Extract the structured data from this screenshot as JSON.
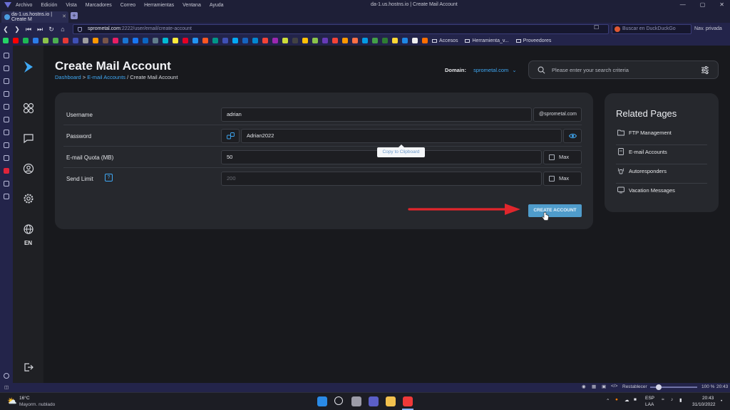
{
  "browser": {
    "menu": [
      "Archivo",
      "Edición",
      "Vista",
      "Marcadores",
      "Correo",
      "Herramientas",
      "Ventana",
      "Ayuda"
    ],
    "window_title": "da-1.us.hostns.io | Create Mail Account",
    "tab_title": "da-1.us.hostns.io | Create M",
    "url_host": "sprometal.com",
    "url_path": ":2222/user/email/create-account",
    "search_placeholder": "Buscar en DuckDuckGo",
    "private_label": "Nav. privada",
    "bookmarks": [
      "Accesos",
      "Herramienta_v...",
      "Proveedores"
    ],
    "statusbar": {
      "reset": "Restablecer",
      "zoom": "100 %",
      "time": "20:43"
    }
  },
  "app": {
    "nav_items": [
      "apps-icon",
      "chat-icon",
      "user-icon",
      "gear-icon",
      "globe-icon"
    ],
    "language": "EN",
    "page_title": "Create Mail Account",
    "breadcrumb": {
      "dashboard": "Dashboard",
      "sep": ">",
      "email_accounts": "E-mail Accounts",
      "current": "/ Create Mail Account"
    },
    "domain_label": "Domain:",
    "domain_value": "sprometal.com",
    "search_placeholder": "Please enter your search criteria"
  },
  "form": {
    "username_label": "Username",
    "username_value": "adrian",
    "domain_suffix": "@sprometal.com",
    "password_label": "Password",
    "password_value": "Adrian2022",
    "quota_label": "E-mail Quota (MB)",
    "quota_value": "50",
    "quota_max_label": "Max",
    "send_limit_label": "Send Limit",
    "send_limit_help": "?",
    "send_limit_placeholder": "200",
    "send_limit_max_label": "Max",
    "tooltip": "Copy to Clipboard",
    "create_button": "CREATE ACCOUNT"
  },
  "related": {
    "title": "Related Pages",
    "items": [
      "FTP Management",
      "E-mail Accounts",
      "Autoresponders",
      "Vacation Messages"
    ]
  },
  "taskbar": {
    "weather_temp": "16°C",
    "weather_desc": "Mayorm. nublado",
    "lang1": "ESP",
    "lang2": "LAA",
    "time": "20:43",
    "date": "31/10/2022"
  }
}
